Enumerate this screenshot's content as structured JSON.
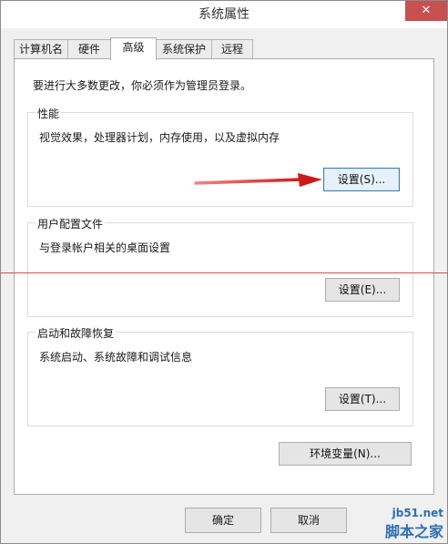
{
  "window": {
    "title": "系统属性",
    "close_label": "✕"
  },
  "tabs": [
    {
      "label": "计算机名"
    },
    {
      "label": "硬件"
    },
    {
      "label": "高级"
    },
    {
      "label": "系统保护"
    },
    {
      "label": "远程"
    }
  ],
  "panel": {
    "intro": "要进行大多数更改，你必须作为管理员登录。",
    "performance": {
      "label": "性能",
      "desc": "视觉效果，处理器计划，内存使用，以及虚拟内存",
      "button": "设置(S)..."
    },
    "profile": {
      "label": "用户配置文件",
      "desc": "与登录帐户相关的桌面设置",
      "button": "设置(E)..."
    },
    "startup": {
      "label": "启动和故障恢复",
      "desc": "系统启动、系统故障和调试信息",
      "button": "设置(T)..."
    },
    "env_button": "环境变量(N)..."
  },
  "footer": {
    "ok": "确定",
    "cancel": "取消"
  },
  "watermark": {
    "site": "jb51.net",
    "name": "脚本之家"
  },
  "colors": {
    "close_red": "#c75050",
    "annotation_red": "#e02020",
    "focus_blue": "#3c7fb1"
  }
}
